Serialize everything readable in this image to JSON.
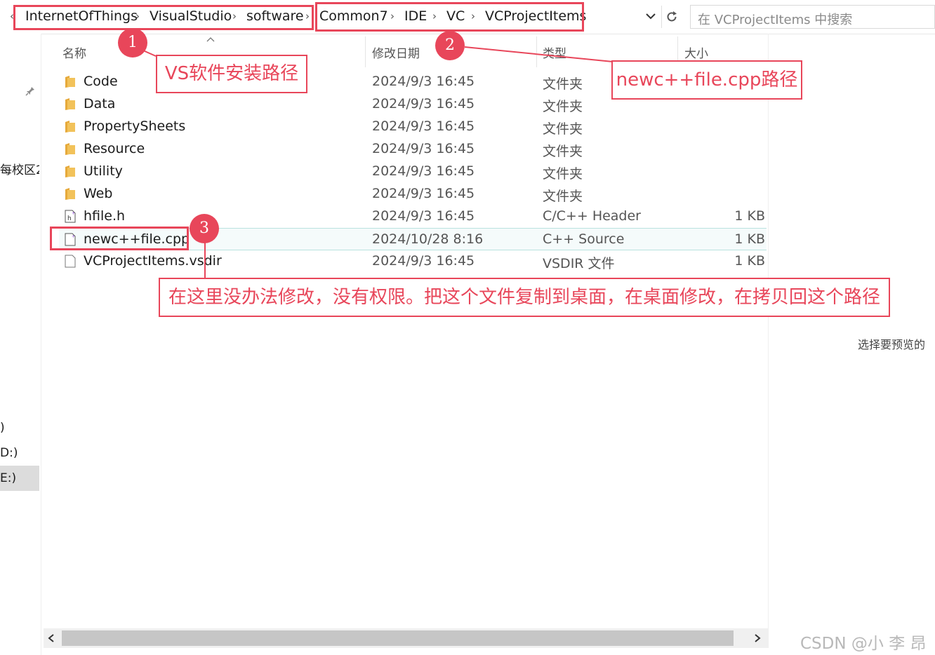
{
  "address": {
    "crumbs": [
      "InternetOfThings",
      "VisualStudio",
      "software",
      "Common7",
      "IDE",
      "VC",
      "VCProjectItems"
    ],
    "search_placeholder": "在 VCProjectItems 中搜索"
  },
  "nav": {
    "partial_text_1": "每校区2(",
    "partial_text_2": ")",
    "partial_text_3": "D:)",
    "partial_text_4": "E:)"
  },
  "columns": {
    "name": "名称",
    "date": "修改日期",
    "type": "类型",
    "size": "大小"
  },
  "files": [
    {
      "name": "Code",
      "date": "2024/9/3 16:45",
      "type": "文件夹",
      "size": "",
      "icon": "folder-icon"
    },
    {
      "name": "Data",
      "date": "2024/9/3 16:45",
      "type": "文件夹",
      "size": "",
      "icon": "folder-icon"
    },
    {
      "name": "PropertySheets",
      "date": "2024/9/3 16:45",
      "type": "文件夹",
      "size": "",
      "icon": "folder-icon"
    },
    {
      "name": "Resource",
      "date": "2024/9/3 16:45",
      "type": "文件夹",
      "size": "",
      "icon": "folder-icon"
    },
    {
      "name": "Utility",
      "date": "2024/9/3 16:45",
      "type": "文件夹",
      "size": "",
      "icon": "folder-icon"
    },
    {
      "name": "Web",
      "date": "2024/9/3 16:45",
      "type": "文件夹",
      "size": "",
      "icon": "folder-icon"
    },
    {
      "name": "hfile.h",
      "date": "2024/9/3 16:45",
      "type": "C/C++ Header",
      "size": "1 KB",
      "icon": "header-file-icon"
    },
    {
      "name": "newc++file.cpp",
      "date": "2024/10/28 8:16",
      "type": "C++ Source",
      "size": "1 KB",
      "icon": "cpp-file-icon"
    },
    {
      "name": "VCProjectItems.vsdir",
      "date": "2024/9/3 16:45",
      "type": "VSDIR 文件",
      "size": "1 KB",
      "icon": "file-icon"
    }
  ],
  "preview_hint": "选择要预览的",
  "annotations": {
    "badge1": "1",
    "badge2": "2",
    "badge3": "3",
    "note1": "VS软件安装路径",
    "note2": "newc++file.cpp路径",
    "note3": "在这里没办法修改，没有权限。把这个文件复制到桌面，在桌面修改，在拷贝回这个路径"
  },
  "watermark": "CSDN @小 李 昂",
  "colors": {
    "accent": "#e8465a",
    "selected_row": "#f5fbfb",
    "folder": "#f2c25a"
  }
}
